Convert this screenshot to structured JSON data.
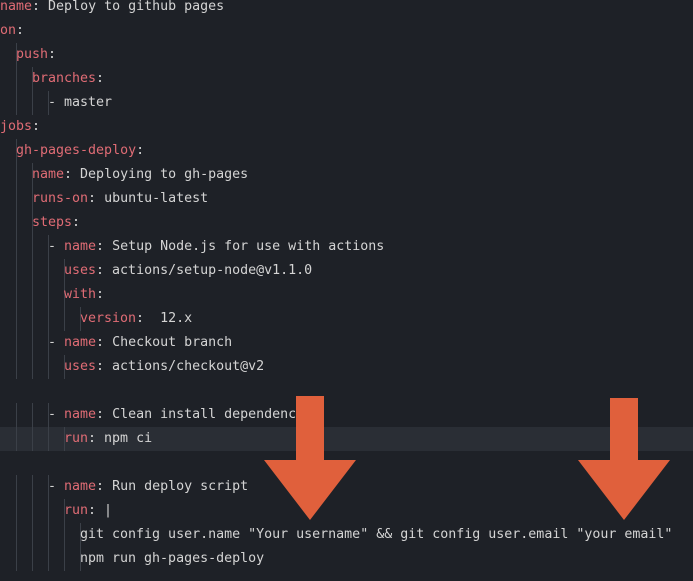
{
  "editor": {
    "language": "yaml",
    "colors": {
      "background": "#1e2127",
      "current_line": "#2a2e35",
      "key": "#e06c75",
      "text": "#d4d4d4",
      "arrow": "#e0603c"
    },
    "lines": [
      {
        "key": "name",
        "sep": ": ",
        "value": "Deploy to github pages"
      },
      {
        "key": "on",
        "sep": ":",
        "value": ""
      },
      {
        "key": "push",
        "sep": ":",
        "value": ""
      },
      {
        "key": "branches",
        "sep": ":",
        "value": ""
      },
      {
        "prefix": "- ",
        "value": "master"
      },
      {
        "key": "jobs",
        "sep": ":",
        "value": ""
      },
      {
        "key": "gh-pages-deploy",
        "sep": ":",
        "value": ""
      },
      {
        "key": "name",
        "sep": ": ",
        "value": "Deploying to gh-pages"
      },
      {
        "key": "runs-on",
        "sep": ": ",
        "value": "ubuntu-latest"
      },
      {
        "key": "steps",
        "sep": ":",
        "value": ""
      },
      {
        "prefix": "- ",
        "key": "name",
        "sep": ": ",
        "value": "Setup Node.js for use with actions"
      },
      {
        "key": "uses",
        "sep": ": ",
        "value": "actions/setup-node@v1.1.0"
      },
      {
        "key": "with",
        "sep": ":",
        "value": ""
      },
      {
        "key": "version",
        "sep": ":  ",
        "value": "12.x"
      },
      {
        "prefix": "- ",
        "key": "name",
        "sep": ": ",
        "value": "Checkout branch"
      },
      {
        "key": "uses",
        "sep": ": ",
        "value": "actions/checkout@v2"
      },
      {
        "value": ""
      },
      {
        "prefix": "- ",
        "key": "name",
        "sep": ": ",
        "value": "Clean install dependencies"
      },
      {
        "key": "run",
        "sep": ": ",
        "value": "npm ci"
      },
      {
        "value": ""
      },
      {
        "prefix": "- ",
        "key": "name",
        "sep": ": ",
        "value": "Run deploy script"
      },
      {
        "key": "run",
        "sep": ": ",
        "value": "|"
      },
      {
        "value": "git config user.name \"Your username\" && git config user.email \"your email\""
      },
      {
        "value": "npm run gh-pages-deploy"
      }
    ]
  },
  "annotations": [
    {
      "type": "arrow-down-icon",
      "target": "Your username"
    },
    {
      "type": "arrow-down-icon",
      "target": "your email"
    }
  ]
}
